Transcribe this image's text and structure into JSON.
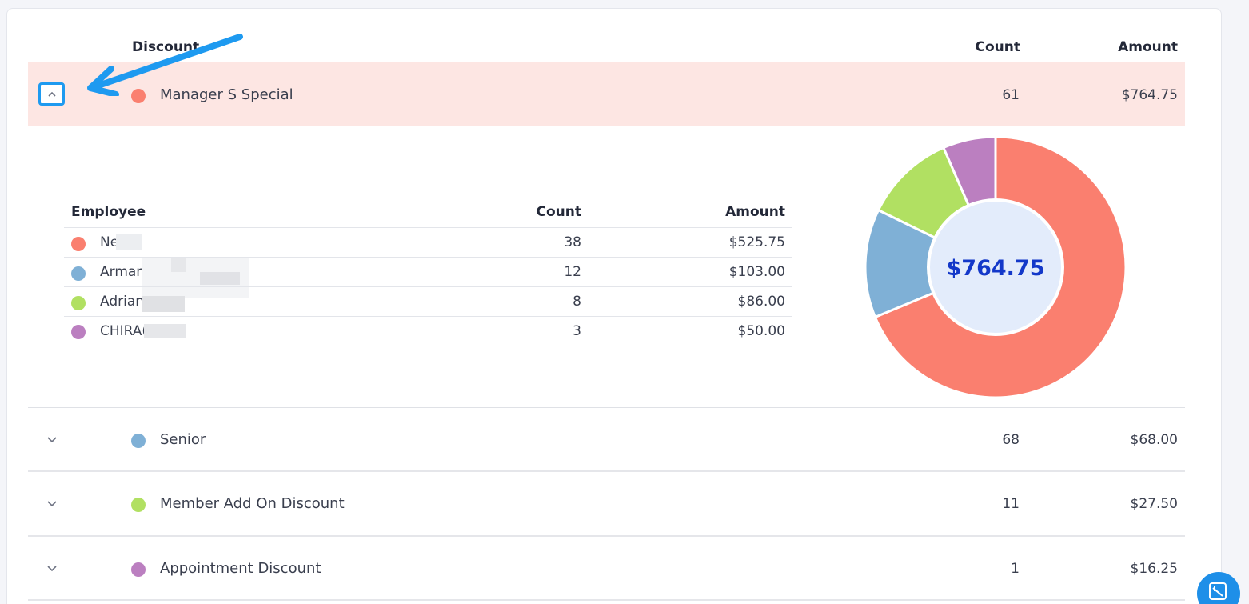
{
  "table": {
    "headers": {
      "discount": "Discount",
      "count": "Count",
      "amount": "Amount"
    },
    "rows": [
      {
        "name": "Manager S Special",
        "count": "61",
        "amount": "$764.75",
        "color": "#fa7f6f",
        "expanded": true
      },
      {
        "name": "Senior",
        "count": "68",
        "amount": "$68.00",
        "color": "#7fb0d6",
        "expanded": false
      },
      {
        "name": "Member Add On Discount",
        "count": "11",
        "amount": "$27.50",
        "color": "#b1e062",
        "expanded": false
      },
      {
        "name": "Appointment Discount",
        "count": "1",
        "amount": "$16.25",
        "color": "#bb7fc0",
        "expanded": false
      }
    ]
  },
  "details": {
    "headers": {
      "employee": "Employee",
      "count": "Count",
      "amount": "Amount"
    },
    "rows": [
      {
        "name": "Ne",
        "count": "38",
        "amount": "$525.75",
        "value": 525.75,
        "color": "#fa7f6f"
      },
      {
        "name": "Arman",
        "count": "12",
        "amount": "$103.00",
        "value": 103.0,
        "color": "#7fb0d6"
      },
      {
        "name": "Adrian",
        "count": "8",
        "amount": "$86.00",
        "value": 86.0,
        "color": "#b1e062"
      },
      {
        "name": "CHIRA(",
        "count": "3",
        "amount": "$50.00",
        "value": 50.0,
        "color": "#bb7fc0"
      }
    ],
    "total_label": "$764.75"
  },
  "icons": {
    "collapse": "chevron-up-icon",
    "expand": "chevron-down-icon",
    "annotation": "arrow-annotation",
    "fab": "support-icon"
  },
  "colors": {
    "accent": "#1e9af0",
    "total_text": "#1338c9",
    "donut_center": "#e3ecfb"
  }
}
